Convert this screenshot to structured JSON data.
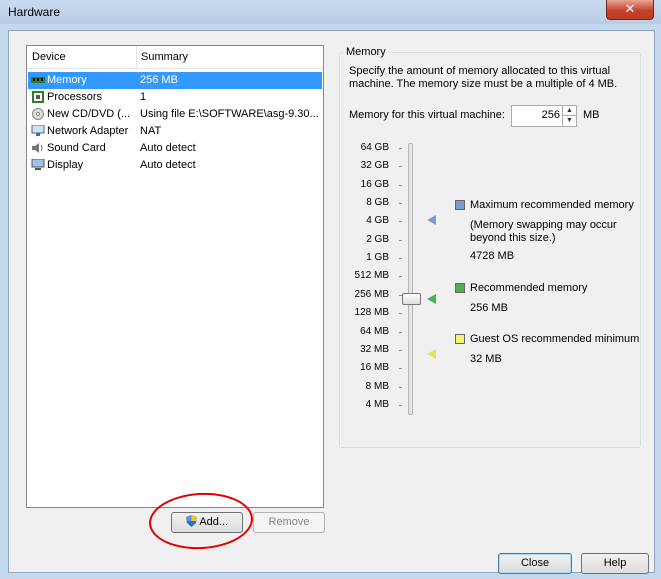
{
  "window": {
    "title": "Hardware",
    "close_glyph": "✕"
  },
  "devices": {
    "col_device": "Device",
    "col_summary": "Summary",
    "rows": [
      {
        "name": "Memory",
        "summary": "256 MB",
        "icon": "memory-icon",
        "selected": true
      },
      {
        "name": "Processors",
        "summary": "1",
        "icon": "processor-icon"
      },
      {
        "name": "New CD/DVD (...",
        "summary": "Using file E:\\SOFTWARE\\asg-9.30...",
        "icon": "cd-dvd-icon"
      },
      {
        "name": "Network Adapter",
        "summary": "NAT",
        "icon": "network-adapter-icon"
      },
      {
        "name": "Sound Card",
        "summary": "Auto detect",
        "icon": "sound-card-icon"
      },
      {
        "name": "Display",
        "summary": "Auto detect",
        "icon": "display-icon"
      }
    ]
  },
  "memory": {
    "group_label": "Memory",
    "description": "Specify the amount of memory allocated to this virtual machine. The memory size must be a multiple of 4 MB.",
    "field_label": "Memory for this virtual machine:",
    "value": "256",
    "unit": "MB",
    "scale": [
      "64 GB",
      "32 GB",
      "16 GB",
      "8 GB",
      "4 GB",
      "2 GB",
      "1 GB",
      "512 MB",
      "256 MB",
      "128 MB",
      "64 MB",
      "32 MB",
      "16 MB",
      "8 MB",
      "4 MB"
    ],
    "legend": [
      {
        "label": "Maximum recommended memory",
        "note": "(Memory swapping may occur beyond this size.)",
        "value": "4728 MB",
        "color": "#7b9cd1"
      },
      {
        "label": "Recommended memory",
        "value": "256 MB",
        "color": "#4caf50"
      },
      {
        "label": "Guest OS recommended minimum",
        "value": "32 MB",
        "color": "#f4f46c"
      }
    ]
  },
  "buttons": {
    "add": "Add...",
    "remove": "Remove",
    "close": "Close",
    "help": "Help"
  },
  "colors": {
    "selection": "#3399ff",
    "annotation": "#e00000"
  }
}
